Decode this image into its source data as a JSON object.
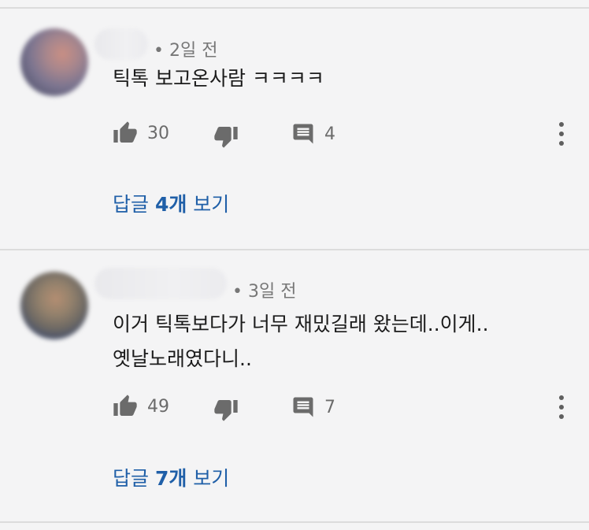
{
  "comments": [
    {
      "time_ago": "• 2일 전",
      "text": "틱톡 보고온사람 ㅋㅋㅋㅋ",
      "likes": "30",
      "reply_count": "4",
      "replies_link": {
        "prefix": "답글 ",
        "count": "4개",
        "suffix": " 보기"
      }
    },
    {
      "time_ago": "• 3일 전",
      "text": "이거 틱톡보다가 너무 재밌길래 왔는데..이게..옛날노래였다니..",
      "likes": "49",
      "reply_count": "7",
      "replies_link": {
        "prefix": "답글 ",
        "count": "7개",
        "suffix": " 보기"
      }
    }
  ],
  "icons": {
    "like": "thumbs-up-icon",
    "dislike": "thumbs-down-icon",
    "reply": "comment-icon",
    "more": "more-vertical-icon"
  },
  "colors": {
    "background": "#f4f4f5",
    "link": "#1f5fa8",
    "icon": "#6b6b6b"
  }
}
